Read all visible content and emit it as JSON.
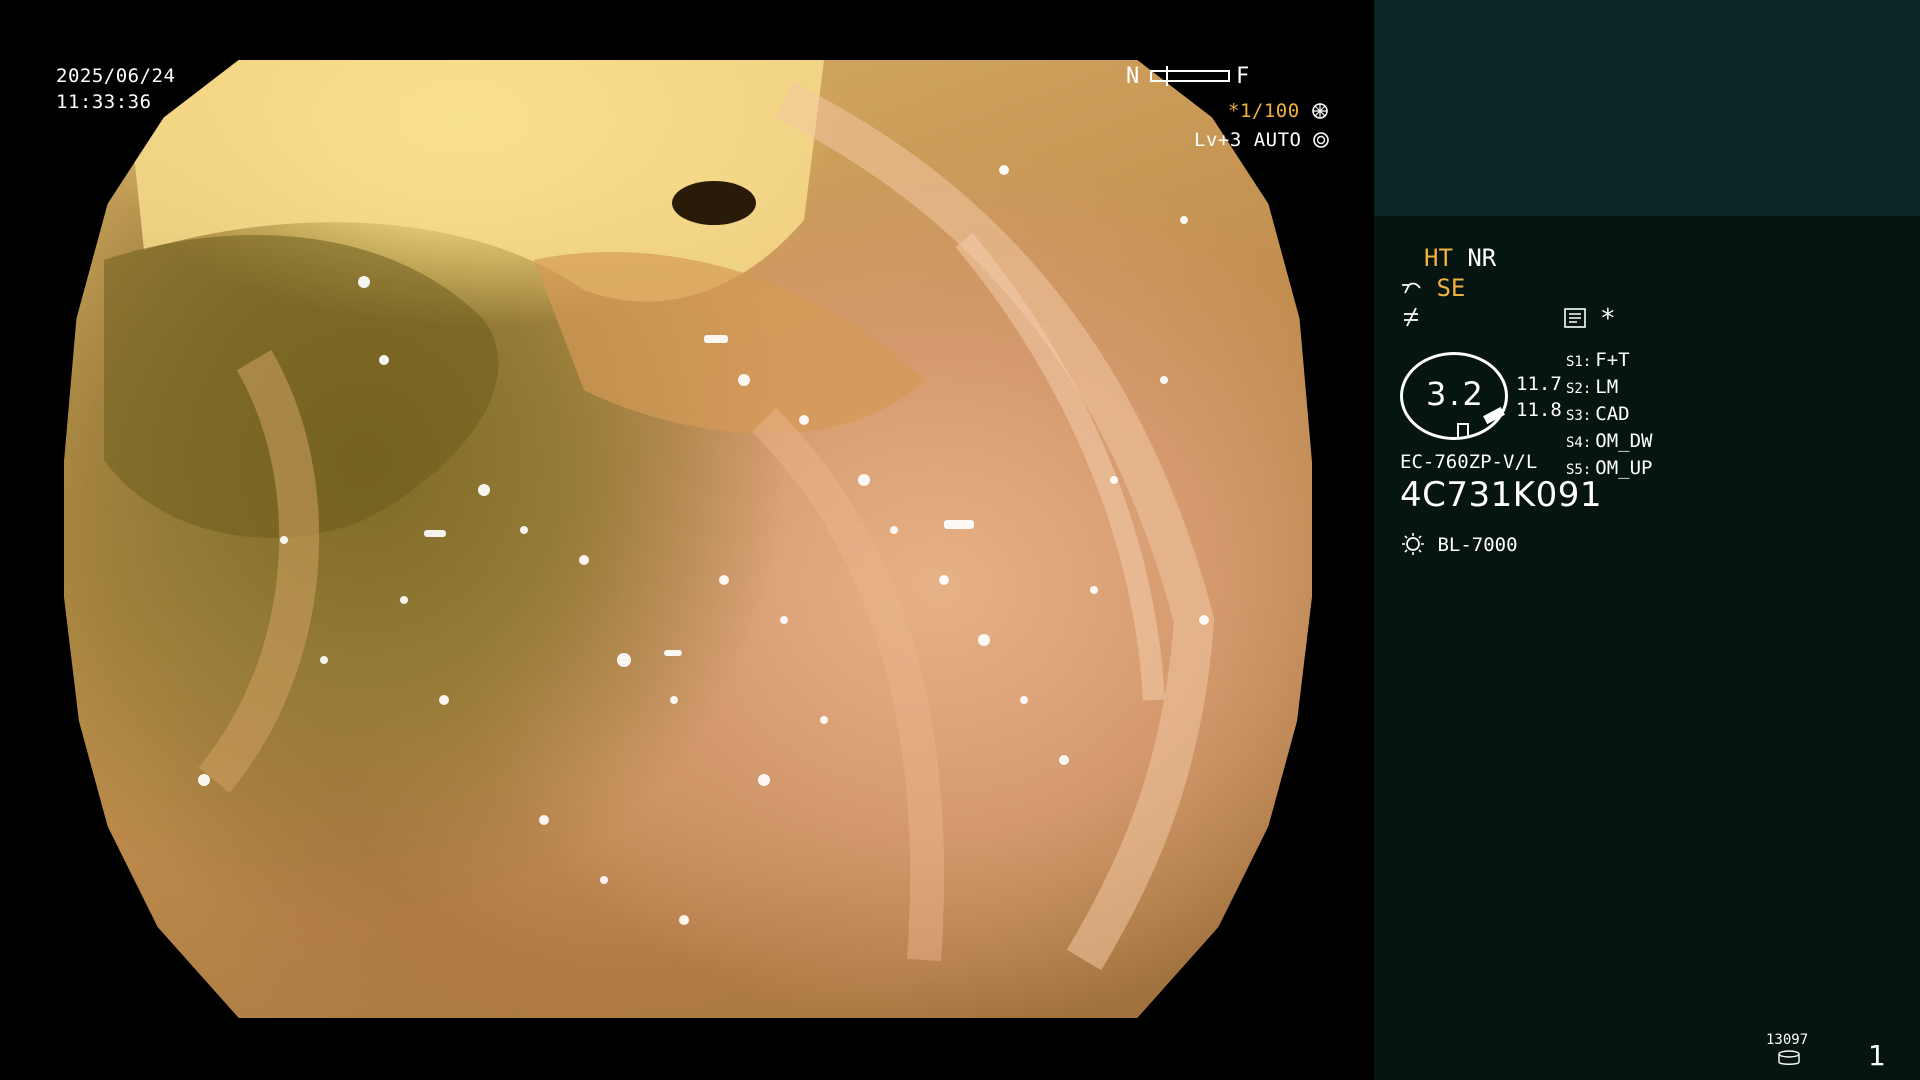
{
  "overlay": {
    "date": "2025/06/24",
    "time": "11:33:36",
    "near_label": "N",
    "far_label": "F",
    "shutter": "*1/100",
    "shutter_icon": "aperture-icon",
    "level": "Lv+3 AUTO",
    "level_icon": "iris-icon"
  },
  "panel": {
    "ht": "HT",
    "nr": "NR",
    "se": "SE",
    "se_icon": "sensor-icon",
    "lightning_icon": "not-equal-icon",
    "memo_icon": "memo-icon",
    "asterisk": "*",
    "capacity": "3.2",
    "val_top": "11.7",
    "val_bottom": "11.8",
    "scope_model": "EC-760ZP-V/L",
    "serial": "4C731K091",
    "light_source_icon": "sun-icon",
    "light_source": "BL-7000",
    "modes": [
      {
        "code": "S1:",
        "name": "F+T"
      },
      {
        "code": "S2:",
        "name": "LM"
      },
      {
        "code": "S3:",
        "name": "CAD"
      },
      {
        "code": "S4:",
        "name": "OM_DW"
      },
      {
        "code": "S5:",
        "name": "OM_UP"
      }
    ],
    "counter": "13097",
    "counter_icon": "storage-icon",
    "page_number": "1"
  },
  "colors": {
    "accent_yellow": "#f0b23c",
    "panel_top": "#0b2624",
    "panel_bottom": "#061412"
  }
}
